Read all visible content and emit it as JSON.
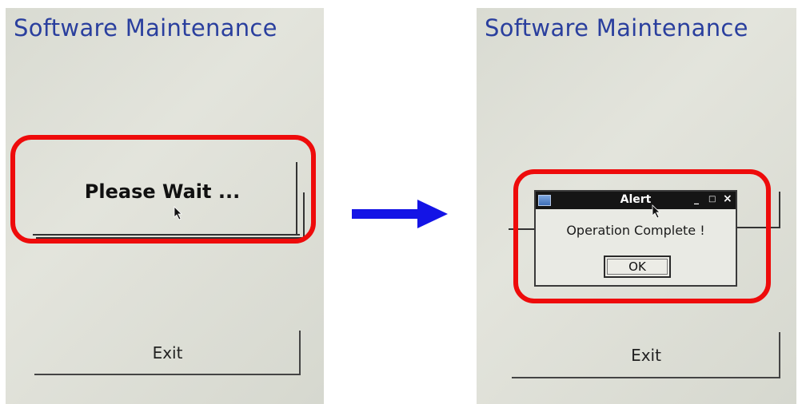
{
  "before": {
    "title": "Software Maintenance",
    "status_button_label": "Please Wait ...",
    "exit_label": "Exit"
  },
  "after": {
    "title": "Software Maintenance",
    "alert": {
      "window_title": "Alert",
      "minimize_glyph": "_",
      "maximize_glyph": "□",
      "close_glyph": "×",
      "message": "Operation Complete !",
      "ok_label": "OK"
    },
    "exit_label": "Exit"
  },
  "colors": {
    "highlight": "#ee0b0b",
    "arrow": "#1414e6",
    "title_text": "#2a3f9e"
  },
  "icons": [
    "mouse-pointer-icon",
    "right-arrow-icon",
    "app-window-icon"
  ]
}
